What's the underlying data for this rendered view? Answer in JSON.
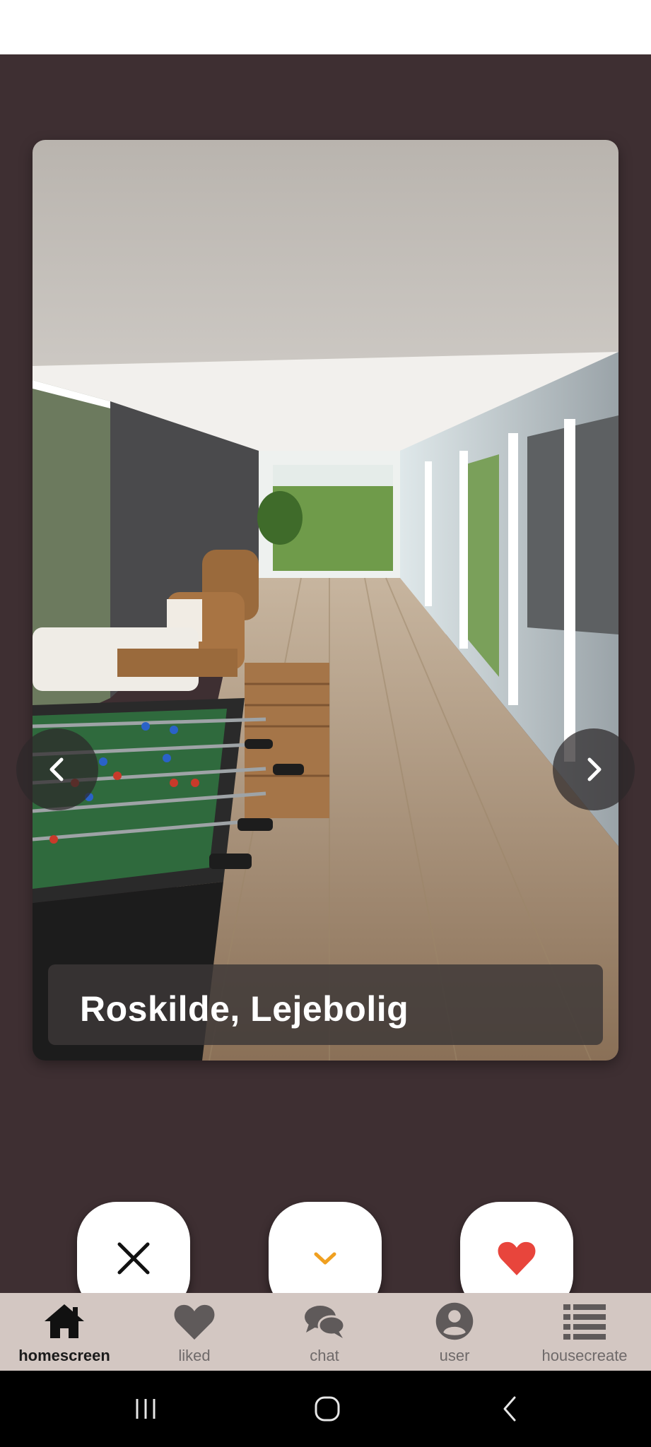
{
  "listing": {
    "title": "Roskilde, Lejebolig"
  },
  "actions": {
    "dislike_icon": "close-icon",
    "more_icon": "chevron-down-icon",
    "like_icon": "heart-icon"
  },
  "nav": {
    "items": [
      {
        "label": "homescreen",
        "icon": "home-icon",
        "active": true
      },
      {
        "label": "liked",
        "icon": "heart-icon",
        "active": false
      },
      {
        "label": "chat",
        "icon": "chat-icon",
        "active": false
      },
      {
        "label": "user",
        "icon": "user-icon",
        "active": false
      },
      {
        "label": "housecreate",
        "icon": "list-icon",
        "active": false
      }
    ]
  },
  "colors": {
    "background": "#3e2f32",
    "nav_background": "#d3c7c2",
    "like": "#e8453c",
    "more": "#f0a020"
  }
}
